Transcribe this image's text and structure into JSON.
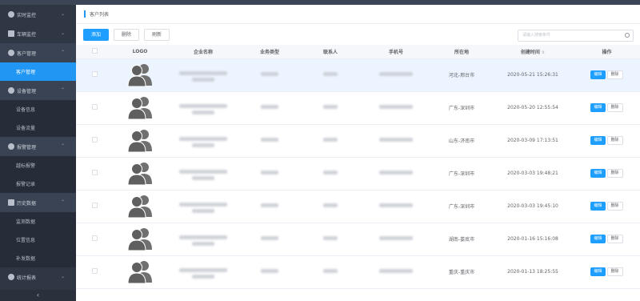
{
  "sidebar": {
    "groups": [
      {
        "label": "实时监控",
        "icon": "monitor-icon"
      },
      {
        "label": "车辆监控",
        "icon": "car-icon"
      },
      {
        "label": "客户管理",
        "icon": "user-icon"
      },
      {
        "label": "设备管理",
        "icon": "device-icon"
      },
      {
        "label": "报警管理",
        "icon": "alarm-icon"
      },
      {
        "label": "历史数据",
        "icon": "history-icon"
      },
      {
        "label": "统计报表",
        "icon": "report-icon"
      }
    ],
    "subs": {
      "customer": [
        {
          "label": "客户管理"
        }
      ],
      "device": [
        {
          "label": "设备信息"
        },
        {
          "label": "设备流量"
        }
      ],
      "alarm": [
        {
          "label": "越标报警"
        },
        {
          "label": "报警记录"
        }
      ],
      "history": [
        {
          "label": "监测数据"
        },
        {
          "label": "位置信息"
        },
        {
          "label": "补发数据"
        }
      ]
    },
    "collapse": "‹"
  },
  "breadcrumb": {
    "title": "客户列表"
  },
  "toolbar": {
    "add": "添加",
    "delete": "删除",
    "refresh": "刷新"
  },
  "search": {
    "placeholder": "请输入搜索条件"
  },
  "table": {
    "headers": [
      "LOGO",
      "企业名称",
      "业务类型",
      "联系人",
      "手机号",
      "所在地",
      "创建时间",
      "操作"
    ],
    "sort_mark": "⇅",
    "edit_label": "编辑",
    "delete_label": "删除",
    "rows": [
      {
        "location": "河北-邢台市",
        "created": "2020-05-21 15:26:31"
      },
      {
        "location": "广东-深圳市",
        "created": "2020-05-20 12:55:54"
      },
      {
        "location": "山东-济南市",
        "created": "2020-03-09 17:13:51"
      },
      {
        "location": "广东-深圳市",
        "created": "2020-03-03 19:48:21"
      },
      {
        "location": "广东-深圳市",
        "created": "2020-03-03 19:45:10"
      },
      {
        "location": "湖南-娄底市",
        "created": "2020-01-16 15:16:08"
      },
      {
        "location": "重庆-重庆市",
        "created": "2020-01-13 18:25:55"
      }
    ]
  },
  "colors": {
    "accent": "#1e9fff",
    "sidebar_bg": "#2f3744",
    "active_bg": "#2196f3"
  }
}
